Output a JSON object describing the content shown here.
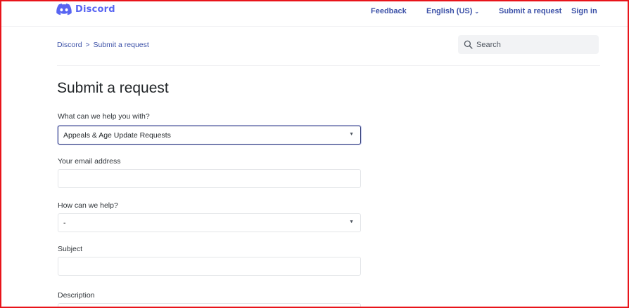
{
  "header": {
    "brand": "Discord",
    "nav": {
      "feedback": "Feedback",
      "language": "English (US)",
      "submit_request": "Submit a request",
      "sign_in": "Sign in"
    }
  },
  "breadcrumb": {
    "items": [
      "Discord",
      "Submit a request"
    ],
    "separator": ">"
  },
  "search": {
    "placeholder": "Search"
  },
  "page": {
    "title": "Submit a request"
  },
  "form": {
    "help_topic": {
      "label": "What can we help you with?",
      "selected": "Appeals & Age Update Requests"
    },
    "email": {
      "label": "Your email address",
      "value": ""
    },
    "how_help": {
      "label": "How can we help?",
      "selected": "-"
    },
    "subject": {
      "label": "Subject",
      "value": ""
    },
    "description": {
      "label": "Description",
      "value": ""
    }
  },
  "colors": {
    "brand": "#5865f2",
    "link": "#3d52a8",
    "frame_border": "#e8141b",
    "active_field_border": "#2f3a78"
  },
  "icons": {
    "logo": "discord-logo-icon",
    "search": "search-icon",
    "dropdown": "chevron-down-icon"
  }
}
